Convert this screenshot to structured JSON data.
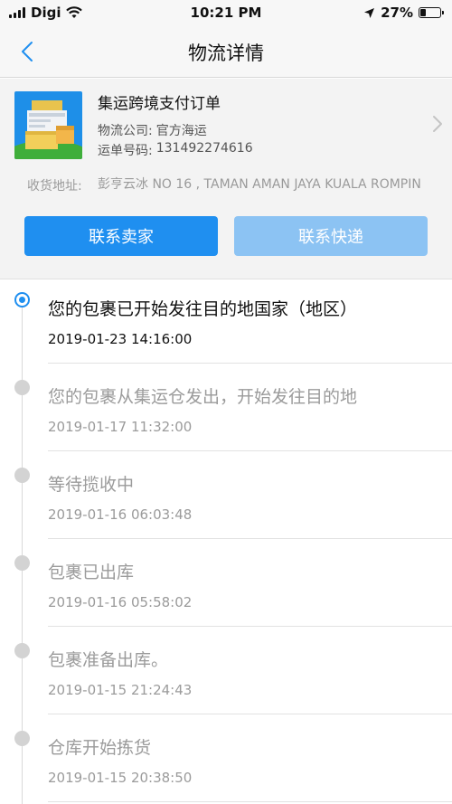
{
  "status_bar": {
    "carrier": "Digi",
    "time": "10:21 PM",
    "battery": "27%",
    "battery_level": 0.27
  },
  "nav": {
    "title": "物流详情"
  },
  "order": {
    "title": "集运跨境支付订单",
    "company_label": "物流公司:",
    "company_value": "官方海运",
    "tracking_label": "运单号码:",
    "tracking_value": "131492274616",
    "address_label": "收货地址:",
    "address_text": "彭亨云冰 NO 16 , TAMAN AMAN JAYA KUALA ROMPIN",
    "contact_seller": "联系卖家",
    "contact_express": "联系快递"
  },
  "timeline": [
    {
      "text": "您的包裹已开始发往目的地国家（地区）",
      "time": "2019-01-23 14:16:00",
      "current": true
    },
    {
      "text": "您的包裹从集运仓发出，开始发往目的地",
      "time": "2019-01-17 11:32:00",
      "current": false
    },
    {
      "text": "等待揽收中",
      "time": "2019-01-16 06:03:48",
      "current": false
    },
    {
      "text": "包裹已出库",
      "time": "2019-01-16 05:58:02",
      "current": false
    },
    {
      "text": "包裹准备出库。",
      "time": "2019-01-15 21:24:43",
      "current": false
    },
    {
      "text": "仓库开始拣货",
      "time": "2019-01-15 20:38:50",
      "current": false
    }
  ],
  "colors": {
    "accent": "#1f8ff0",
    "accent_light": "#8cc3f3"
  }
}
